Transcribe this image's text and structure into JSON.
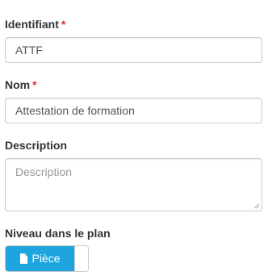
{
  "form": {
    "identifiant": {
      "label": "Identifiant",
      "required_mark": "*",
      "value": "ATTF"
    },
    "nom": {
      "label": "Nom",
      "required_mark": "*",
      "value": "Attestation de formation"
    },
    "description": {
      "label": "Description",
      "placeholder": "Description",
      "value": ""
    },
    "niveau": {
      "label": "Niveau dans le plan",
      "toggle_label": "Pièce",
      "toggle_icon": "document-icon",
      "toggle_state": "on"
    }
  },
  "colors": {
    "required": "#e02b27",
    "toggle_on_bg": "#1ea5df",
    "border": "#cccccc",
    "label_text": "#333333",
    "input_text": "#555555",
    "placeholder_text": "#999999"
  }
}
